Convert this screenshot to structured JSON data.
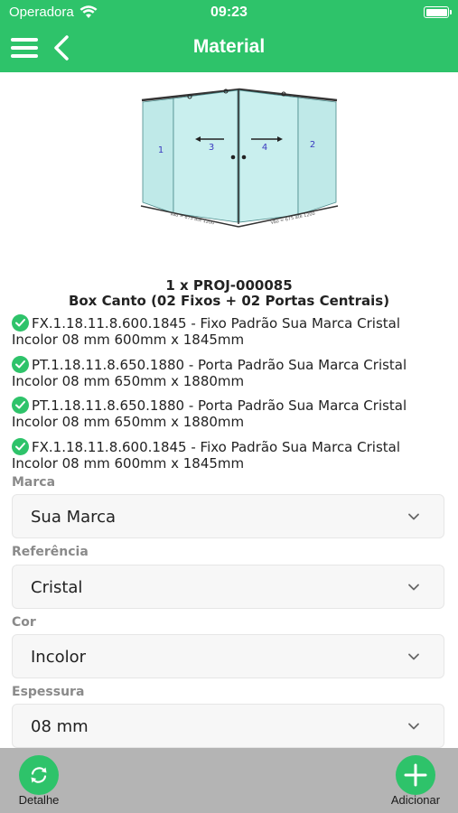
{
  "status_bar": {
    "carrier": "Operadora",
    "time": "09:23",
    "icons": [
      "wifi-icon",
      "battery-icon"
    ]
  },
  "nav": {
    "title": "Material",
    "icons": [
      "menu-icon",
      "back-icon"
    ]
  },
  "drawing": {
    "panels": [
      "1",
      "3",
      "4",
      "2"
    ],
    "labels": {
      "width_left": "Vão = 675 até 1200",
      "width_right": "Vão = 675 até 1200"
    }
  },
  "project": {
    "id_line": "1 x PROJ-000085",
    "name": "Box Canto (02 Fixos + 02 Portas Centrais)"
  },
  "items": [
    {
      "text": "FX.1.18.11.8.600.1845 - Fixo Padrão Sua Marca Cristal Incolor 08 mm 600mm x 1845mm"
    },
    {
      "text": "PT.1.18.11.8.650.1880 - Porta Padrão Sua Marca Cristal Incolor 08 mm 650mm x 1880mm"
    },
    {
      "text": "PT.1.18.11.8.650.1880 - Porta Padrão Sua Marca Cristal Incolor 08 mm 650mm x 1880mm"
    },
    {
      "text": "FX.1.18.11.8.600.1845 - Fixo Padrão Sua Marca Cristal Incolor 08 mm 600mm x 1845mm"
    }
  ],
  "fields": {
    "marca": {
      "label": "Marca",
      "value": "Sua Marca"
    },
    "referencia": {
      "label": "Referência",
      "value": "Cristal"
    },
    "cor": {
      "label": "Cor",
      "value": "Incolor"
    },
    "espessura": {
      "label": "Espessura",
      "value": "08 mm"
    }
  },
  "bottom": {
    "detalhe_label": "Detalhe",
    "adicionar_label": "Adicionar"
  },
  "colors": {
    "primary": "#2ec36a",
    "bottom_bar": "#b4b4b4"
  }
}
